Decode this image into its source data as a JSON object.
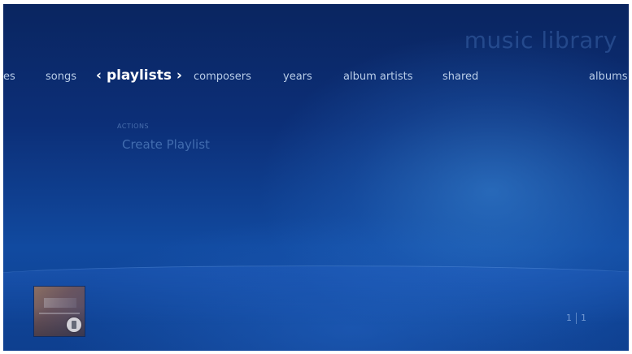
{
  "app": {
    "title": "music library"
  },
  "nav": {
    "items": [
      {
        "label": "es"
      },
      {
        "label": "songs"
      },
      {
        "label": "playlists",
        "selected": true
      },
      {
        "label": "composers"
      },
      {
        "label": "years"
      },
      {
        "label": "album artists"
      },
      {
        "label": "shared"
      },
      {
        "label": "albums"
      }
    ],
    "chevron_left": "‹",
    "chevron_right": "›"
  },
  "actions": {
    "heading": "ACTIONS",
    "items": [
      {
        "label": "Create Playlist"
      }
    ]
  },
  "now_playing": {
    "icon": "album-art-icon"
  },
  "pager": {
    "current": "1",
    "total": "1"
  },
  "colors": {
    "background_dark": "#0a2560",
    "background_light": "#114aa0",
    "nav_text": "#b9cde8",
    "selected_text": "#ffffff"
  }
}
